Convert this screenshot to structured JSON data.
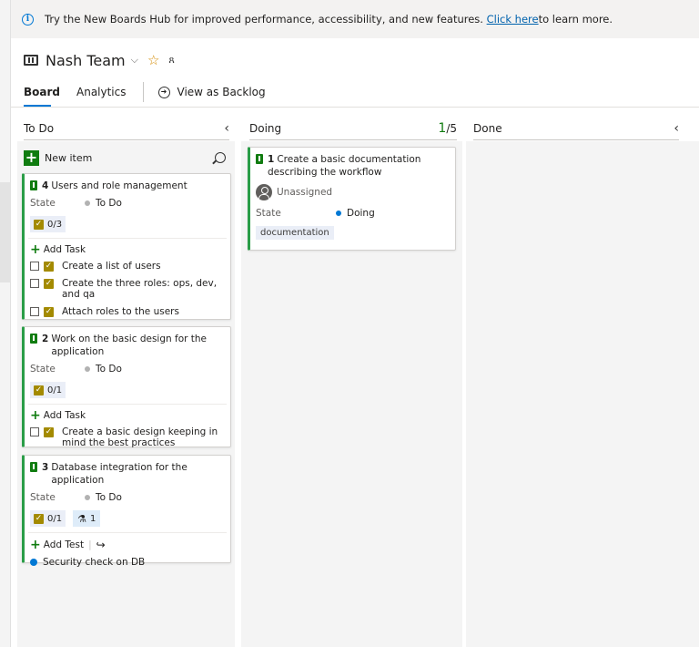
{
  "banner": {
    "text_before": "Try the New Boards Hub for improved performance, accessibility, and new features. ",
    "link_text": "Click here",
    "text_after": " to learn more."
  },
  "header": {
    "team_name": "Nash Team",
    "chevron": "⌵",
    "star": "☆",
    "people_glyph": "ጸ",
    "tabs": [
      "Board",
      "Analytics"
    ],
    "backlog_link": "View as Backlog"
  },
  "columns": {
    "todo": {
      "name": "To Do",
      "collapse_glyph": "‹"
    },
    "doing": {
      "name": "Doing",
      "wip_current": "1",
      "wip_limit": "/5"
    },
    "done": {
      "name": "Done",
      "collapse_glyph": "‹"
    }
  },
  "new_item_label": "New item",
  "cards": {
    "c4": {
      "id": "4",
      "title": "Users and role management",
      "state_label": "State",
      "state": "To Do",
      "progress": "0/3",
      "add_label": "Add Task",
      "tasks": [
        "Create a list of users",
        "Create the three roles: ops, dev, and qa",
        "Attach roles to the users"
      ]
    },
    "c2": {
      "id": "2",
      "title": "Work on the basic design for the application",
      "state_label": "State",
      "state": "To Do",
      "progress": "0/1",
      "add_label": "Add Task",
      "tasks": [
        "Create a basic design keeping in mind the best practices"
      ]
    },
    "c3": {
      "id": "3",
      "title": "Database integration for the application",
      "state_label": "State",
      "state": "To Do",
      "progress": "0/1",
      "tests": "1",
      "add_label": "Add Test",
      "checks": [
        "Security check on DB"
      ]
    },
    "c1": {
      "id": "1",
      "title": "Create a basic documentation describing the workflow",
      "assignee": "Unassigned",
      "state_label": "State",
      "state": "Doing",
      "tag": "documentation"
    }
  },
  "colors": {
    "accent": "#0078d4",
    "story_bar": "#2a9d47",
    "todo_dot": "#b2b2b2",
    "doing_dot": "#0078d4",
    "wip_green": "#107c10"
  },
  "icons": [
    "info-icon",
    "board-icon",
    "chevron-down-icon",
    "star-icon",
    "people-icon",
    "circle-arrow-icon",
    "collapse-chevron-icon",
    "plus-icon",
    "search-icon",
    "trophy-icon",
    "task-icon",
    "flask-icon",
    "redo-icon",
    "avatar-icon"
  ]
}
